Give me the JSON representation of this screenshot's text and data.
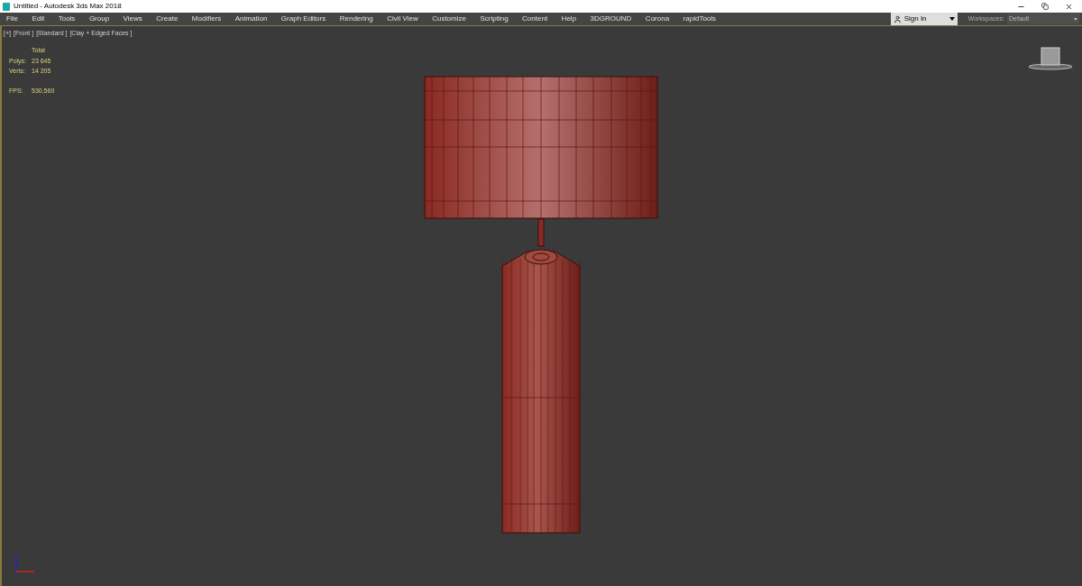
{
  "window": {
    "title": "Untitled - Autodesk 3ds Max 2018"
  },
  "menu": [
    "File",
    "Edit",
    "Tools",
    "Group",
    "Views",
    "Create",
    "Modifiers",
    "Animation",
    "Graph Editors",
    "Rendering",
    "Civil View",
    "Customize",
    "Scripting",
    "Content",
    "Help",
    "3DGROUND",
    "Corona",
    "rapidTools"
  ],
  "sign_in": {
    "label": "Sign In"
  },
  "workspaces": {
    "label": "Workspaces:",
    "value": "Default"
  },
  "viewport": {
    "labels": [
      "[+]",
      "[Front ]",
      "[Standard ]",
      "[Clay + Edged Faces ]"
    ],
    "stats": {
      "header": "Total",
      "rows": [
        {
          "label": "Polys:",
          "value": "23 645"
        },
        {
          "label": "Verts:",
          "value": "14 205"
        }
      ],
      "fps_label": "FPS:",
      "fps_value": "530,560"
    }
  }
}
